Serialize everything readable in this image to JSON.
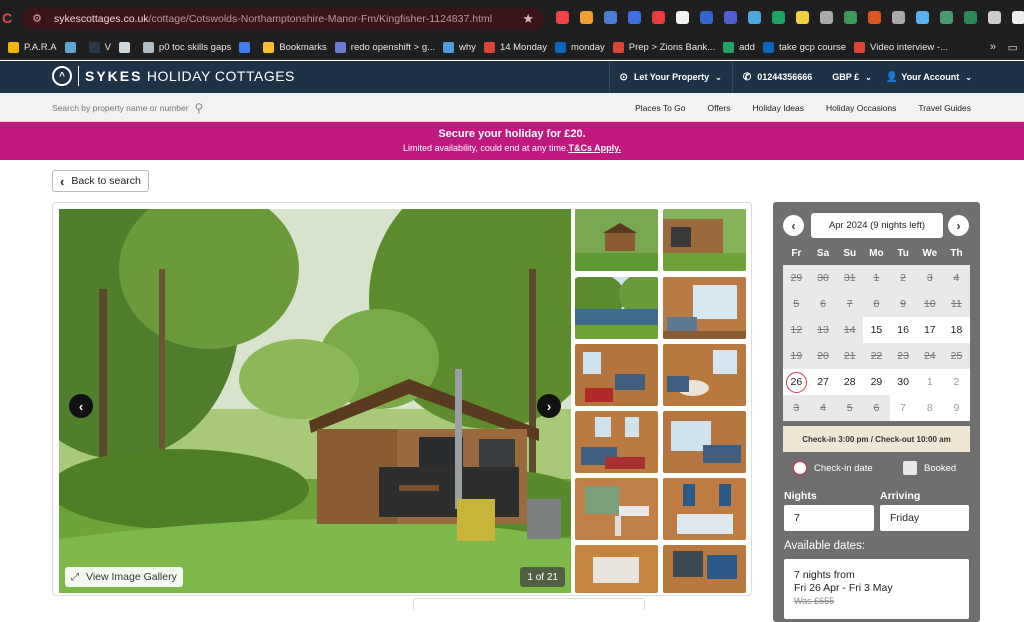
{
  "browser": {
    "url_host": "sykescottages.co.uk",
    "url_path": "/cottage/Cotswolds-Northamptonshire-Manor-Fm/Kingfisher-1124837.html",
    "extensions": [
      "#e44",
      "#f0a030",
      "#4a7fd8",
      "#3f6fe0",
      "#e83c3c",
      "#f3f3f3",
      "#3366cc",
      "#5060d0",
      "#4ea8de",
      "#1fa463",
      "#f0d040",
      "#aaa",
      "#3a9a5a",
      "#dd5522",
      "#aaa",
      "#5ab0f0",
      "#4a9a70",
      "#2a8a5a",
      "#ccc",
      "#eee"
    ],
    "bookmarks": [
      {
        "label": "P.A.R.A",
        "color": "#f2b705"
      },
      {
        "label": "",
        "color": "#5fa8d3"
      },
      {
        "label": "V",
        "color": "#2b3a4a"
      },
      {
        "label": "",
        "color": "#cfd8dc"
      },
      {
        "label": "p0 toc skills gaps",
        "color": "#b0bec5"
      },
      {
        "label": "",
        "color": "#3f7ef0"
      },
      {
        "label": "Bookmarks",
        "color": "#fbc02d"
      },
      {
        "label": "redo openshift > g...",
        "color": "#6a7bd8"
      },
      {
        "label": "why",
        "color": "#4d9de0"
      },
      {
        "label": "14 Monday",
        "color": "#db4437"
      },
      {
        "label": "monday",
        "color": "#0a66c2"
      },
      {
        "label": "Prep > Zions Bank...",
        "color": "#db4437"
      },
      {
        "label": "add",
        "color": "#1fa463"
      },
      {
        "label": "take gcp course",
        "color": "#0a66c2"
      },
      {
        "label": "Video interview -...",
        "color": "#db4437"
      }
    ],
    "more": "»"
  },
  "site": {
    "logo_bold": "SYKES",
    "logo_rest": "HOLIDAY COTTAGES",
    "header": {
      "let_property": "Let Your Property",
      "phone": "01244356666",
      "currency": "GBP £",
      "account": "Your Account"
    },
    "search_placeholder": "Search by property name or number",
    "nav": [
      "Places To Go",
      "Offers",
      "Holiday Ideas",
      "Holiday Occasions",
      "Travel Guides"
    ]
  },
  "promo": {
    "line1": "Secure your holiday for £20.",
    "line2": "Limited availability, could end at any time.",
    "link": "T&Cs Apply."
  },
  "back_label": "Back to search",
  "gallery": {
    "view_label": "View Image Gallery",
    "counter": "1 of 21"
  },
  "calendar": {
    "month": "Apr 2024 (9 nights left)",
    "days_of_week": [
      "Fr",
      "Sa",
      "Su",
      "Mo",
      "Tu",
      "We",
      "Th"
    ],
    "rows": [
      [
        [
          "29",
          "b"
        ],
        [
          "30",
          "b"
        ],
        [
          "31",
          "b"
        ],
        [
          "1",
          "b"
        ],
        [
          "2",
          "b"
        ],
        [
          "3",
          "b"
        ],
        [
          "4",
          "b"
        ]
      ],
      [
        [
          "5",
          "b"
        ],
        [
          "6",
          "b"
        ],
        [
          "7",
          "b"
        ],
        [
          "8",
          "b"
        ],
        [
          "9",
          "b"
        ],
        [
          "10",
          "b"
        ],
        [
          "11",
          "b"
        ]
      ],
      [
        [
          "12",
          "b"
        ],
        [
          "13",
          "b"
        ],
        [
          "14",
          "b"
        ],
        [
          "15",
          "a"
        ],
        [
          "16",
          "a"
        ],
        [
          "17",
          "a"
        ],
        [
          "18",
          "a"
        ]
      ],
      [
        [
          "19",
          "b"
        ],
        [
          "20",
          "b"
        ],
        [
          "21",
          "b"
        ],
        [
          "22",
          "b"
        ],
        [
          "23",
          "b"
        ],
        [
          "24",
          "b"
        ],
        [
          "25",
          "b"
        ]
      ],
      [
        [
          "26",
          "c"
        ],
        [
          "27",
          "a"
        ],
        [
          "28",
          "a"
        ],
        [
          "29",
          "a"
        ],
        [
          "30",
          "a"
        ],
        [
          "1",
          "p"
        ],
        [
          "2",
          "p"
        ]
      ],
      [
        [
          "3",
          "b"
        ],
        [
          "4",
          "b"
        ],
        [
          "5",
          "b"
        ],
        [
          "6",
          "b"
        ],
        [
          "7",
          "p"
        ],
        [
          "8",
          "p"
        ],
        [
          "9",
          "p"
        ]
      ]
    ],
    "checkin_note": "Check-in 3:00 pm / Check-out 10:00 am",
    "legend_checkin": "Check-in date",
    "legend_booked": "Booked",
    "nights_label": "Nights",
    "nights_value": "7",
    "arriving_label": "Arriving",
    "arriving_value": "Friday",
    "available_title": "Available dates:",
    "offer_line1": "7 nights from",
    "offer_line2": "Fri 26 Apr - Fri 3 May",
    "offer_was": "Was £655"
  }
}
